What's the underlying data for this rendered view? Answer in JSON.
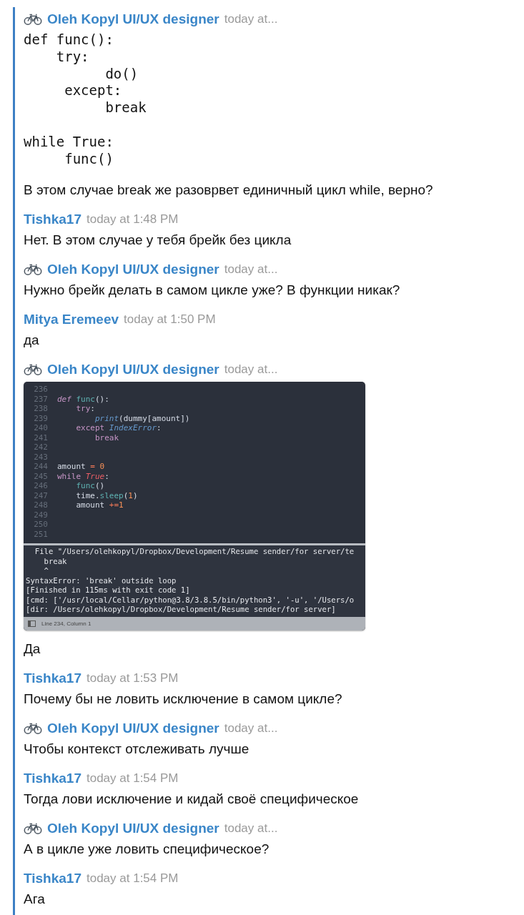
{
  "messages": [
    {
      "author": "Oleh Kopyl UI/UX designer",
      "bike": true,
      "time": "today at...",
      "body": [
        {
          "kind": "code",
          "text": "def func():\n    try:\n          do()\n     except:\n          break\n\nwhile True:\n     func()"
        },
        {
          "kind": "text",
          "text": "В этом случае break же разоврвет единичный цикл while, верно?"
        }
      ]
    },
    {
      "author": "Tishka17",
      "bike": false,
      "time": "today at 1:48 PM",
      "body": [
        {
          "kind": "text",
          "text": "Нет. В этом случае у тебя брейк без цикла"
        }
      ]
    },
    {
      "author": "Oleh Kopyl UI/UX designer",
      "bike": true,
      "time": "today at...",
      "body": [
        {
          "kind": "text",
          "text": "Нужно брейк делать в самом цикле уже? В функции никак?"
        }
      ]
    },
    {
      "author": "Mitya Eremeev",
      "bike": false,
      "time": "today at 1:50 PM",
      "body": [
        {
          "kind": "text",
          "text": "да"
        }
      ]
    },
    {
      "author": "Oleh Kopyl UI/UX designer",
      "bike": true,
      "time": "today at...",
      "body": [
        {
          "kind": "editor",
          "editor": {
            "lines": [
              {
                "number": "236"
              },
              {
                "number": "237",
                "tokens": [
                  {
                    "kind": "storage",
                    "text": "def"
                  },
                  {
                    "kind": "function",
                    "text": " func"
                  },
                  {
                    "kind": "plain",
                    "text": "():"
                  }
                ]
              },
              {
                "number": "238",
                "tokens": [
                  {
                    "kind": "keyword",
                    "text": "    try"
                  },
                  {
                    "kind": "plain",
                    "text": ":"
                  }
                ]
              },
              {
                "number": "239",
                "tokens": [
                  {
                    "kind": "builtin",
                    "text": "        print"
                  },
                  {
                    "kind": "plain",
                    "text": "(dummy[amount])"
                  }
                ]
              },
              {
                "number": "240",
                "tokens": [
                  {
                    "kind": "keyword",
                    "text": "    except"
                  },
                  {
                    "kind": "builtin",
                    "text": " IndexError"
                  },
                  {
                    "kind": "plain",
                    "text": ":"
                  }
                ]
              },
              {
                "number": "241",
                "tokens": [
                  {
                    "kind": "keyword",
                    "text": "        break"
                  }
                ]
              },
              {
                "number": "242"
              },
              {
                "number": "243"
              },
              {
                "number": "244",
                "tokens": [
                  {
                    "kind": "plain",
                    "text": "amount "
                  },
                  {
                    "kind": "operator",
                    "text": "="
                  },
                  {
                    "kind": "number",
                    "text": " 0"
                  }
                ]
              },
              {
                "number": "245",
                "tokens": [
                  {
                    "kind": "keyword",
                    "text": "while"
                  },
                  {
                    "kind": "constant",
                    "text": " True"
                  },
                  {
                    "kind": "plain",
                    "text": ":"
                  }
                ]
              },
              {
                "number": "246",
                "tokens": [
                  {
                    "kind": "function",
                    "text": "    func"
                  },
                  {
                    "kind": "plain",
                    "text": "()"
                  }
                ]
              },
              {
                "number": "247",
                "tokens": [
                  {
                    "kind": "plain",
                    "text": "    time."
                  },
                  {
                    "kind": "function",
                    "text": "sleep"
                  },
                  {
                    "kind": "plain",
                    "text": "("
                  },
                  {
                    "kind": "number",
                    "text": "1"
                  },
                  {
                    "kind": "plain",
                    "text": ")"
                  }
                ]
              },
              {
                "number": "248",
                "tokens": [
                  {
                    "kind": "plain",
                    "text": "    amount "
                  },
                  {
                    "kind": "operator",
                    "text": "+="
                  },
                  {
                    "kind": "number",
                    "text": "1"
                  }
                ]
              },
              {
                "number": "249"
              },
              {
                "number": "250"
              },
              {
                "number": "251"
              }
            ],
            "console": [
              "  File \"/Users/olehkopyl/Dropbox/Development/Resume sender/for server/te",
              "    break",
              "    ^",
              "SyntaxError: 'break' outside loop",
              "[Finished in 115ms with exit code 1]",
              "[cmd: ['/usr/local/Cellar/python@3.8/3.8.5/bin/python3', '-u', '/Users/o",
              "[dir: /Users/olehkopyl/Dropbox/Development/Resume sender/for server]"
            ],
            "status": "Line 234, Column 1"
          }
        },
        {
          "kind": "text",
          "text": "Да"
        }
      ]
    },
    {
      "author": "Tishka17",
      "bike": false,
      "time": "today at 1:53 PM",
      "body": [
        {
          "kind": "text",
          "text": "Почему бы не ловить исключение в самом цикле?"
        }
      ]
    },
    {
      "author": "Oleh Kopyl UI/UX designer",
      "bike": true,
      "time": "today at...",
      "body": [
        {
          "kind": "text",
          "text": "Чтобы контекст отслеживать лучше"
        }
      ]
    },
    {
      "author": "Tishka17",
      "bike": false,
      "time": "today at 1:54 PM",
      "body": [
        {
          "kind": "text",
          "text": "Тогда лови исключение и кидай своё специфическое"
        }
      ]
    },
    {
      "author": "Oleh Kopyl UI/UX designer",
      "bike": true,
      "time": "today at...",
      "body": [
        {
          "kind": "text",
          "text": "А в цикле уже ловить специфическое?"
        }
      ]
    },
    {
      "author": "Tishka17",
      "bike": false,
      "time": "today at 1:54 PM",
      "body": [
        {
          "kind": "text",
          "text": "Ага"
        }
      ]
    }
  ]
}
